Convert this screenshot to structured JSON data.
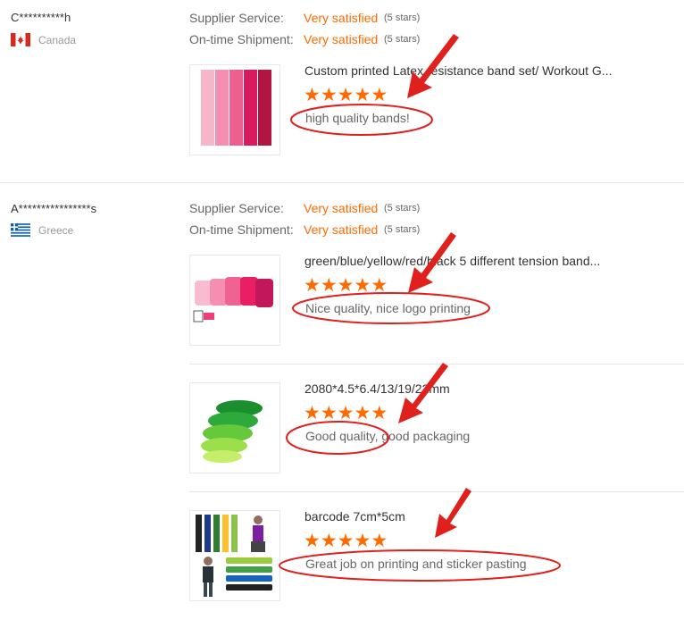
{
  "reviews": [
    {
      "buyer": "C**********h",
      "country": "Canada",
      "supplier_label": "Supplier Service:",
      "supplier_value": "Very satisfied",
      "supplier_stars": "(5 stars)",
      "shipment_label": "On-time Shipment:",
      "shipment_value": "Very satisfied",
      "shipment_stars": "(5 stars)",
      "products": [
        {
          "title": "Custom printed Latex resistance band set/ Workout G...",
          "rating": 5,
          "comment": "high quality bands!"
        }
      ]
    },
    {
      "buyer": "A****************s",
      "country": "Greece",
      "supplier_label": "Supplier Service:",
      "supplier_value": "Very satisfied",
      "supplier_stars": "(5 stars)",
      "shipment_label": "On-time Shipment:",
      "shipment_value": "Very satisfied",
      "shipment_stars": "(5 stars)",
      "products": [
        {
          "title": "green/blue/yellow/red/black 5 different tension band...",
          "rating": 5,
          "comment": "Nice quality, nice logo printing"
        },
        {
          "title": "2080*4.5*6.4/13/19/22mm",
          "rating": 5,
          "comment": "Good quality, good packaging"
        },
        {
          "title": "barcode 7cm*5cm",
          "rating": 5,
          "comment": "Great job on printing and sticker pasting"
        }
      ]
    }
  ],
  "colors": {
    "accent": "#ff6a00",
    "annotation": "#e0201c"
  },
  "icons": {
    "star": "star-icon",
    "flag_canada": "canada-flag-icon",
    "flag_greece": "greece-flag-icon"
  }
}
